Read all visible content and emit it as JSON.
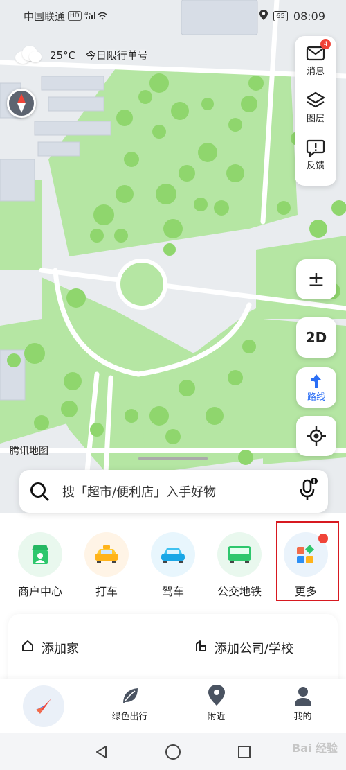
{
  "status": {
    "carrier": "中国联通",
    "hd": "HD",
    "network": "4G",
    "battery": "65",
    "time": "08:09"
  },
  "weather": {
    "temp": "25°C",
    "notice": "今日限行单号"
  },
  "map_tools": [
    {
      "label": "消息",
      "icon": "message-icon",
      "badge": "4"
    },
    {
      "label": "图层",
      "icon": "layers-icon"
    },
    {
      "label": "反馈",
      "icon": "feedback-icon"
    }
  ],
  "controls": {
    "zoom": "±",
    "view_mode": "2D",
    "route": "路线"
  },
  "brand": "腾讯地图",
  "search": {
    "placeholder": "搜「超市/便利店」入手好物"
  },
  "quick_actions": [
    {
      "label": "商户中心",
      "icon": "merchant-store-icon",
      "bg": "#e9f8ee"
    },
    {
      "label": "打车",
      "icon": "taxi-icon",
      "bg": "#fff4e6"
    },
    {
      "label": "驾车",
      "icon": "car-icon",
      "bg": "#e8f6fd"
    },
    {
      "label": "公交地铁",
      "icon": "bus-icon",
      "bg": "#e9f8ee"
    },
    {
      "label": "更多",
      "icon": "more-apps-icon",
      "bg": "#eaf3fb"
    }
  ],
  "places": {
    "home": "添加家",
    "work": "添加公司/学校"
  },
  "bottom_nav": [
    {
      "label": "",
      "icon": "compass-home-icon"
    },
    {
      "label": "绿色出行",
      "icon": "leaf-icon"
    },
    {
      "label": "附近",
      "icon": "location-pin-icon"
    },
    {
      "label": "我的",
      "icon": "profile-icon"
    }
  ],
  "watermark": "Bai 经验",
  "colors": {
    "park_green": "#b5e6a3",
    "tree_green": "#8fd66d",
    "accent_blue": "#2b6ef5",
    "highlight_red": "#d71920"
  }
}
